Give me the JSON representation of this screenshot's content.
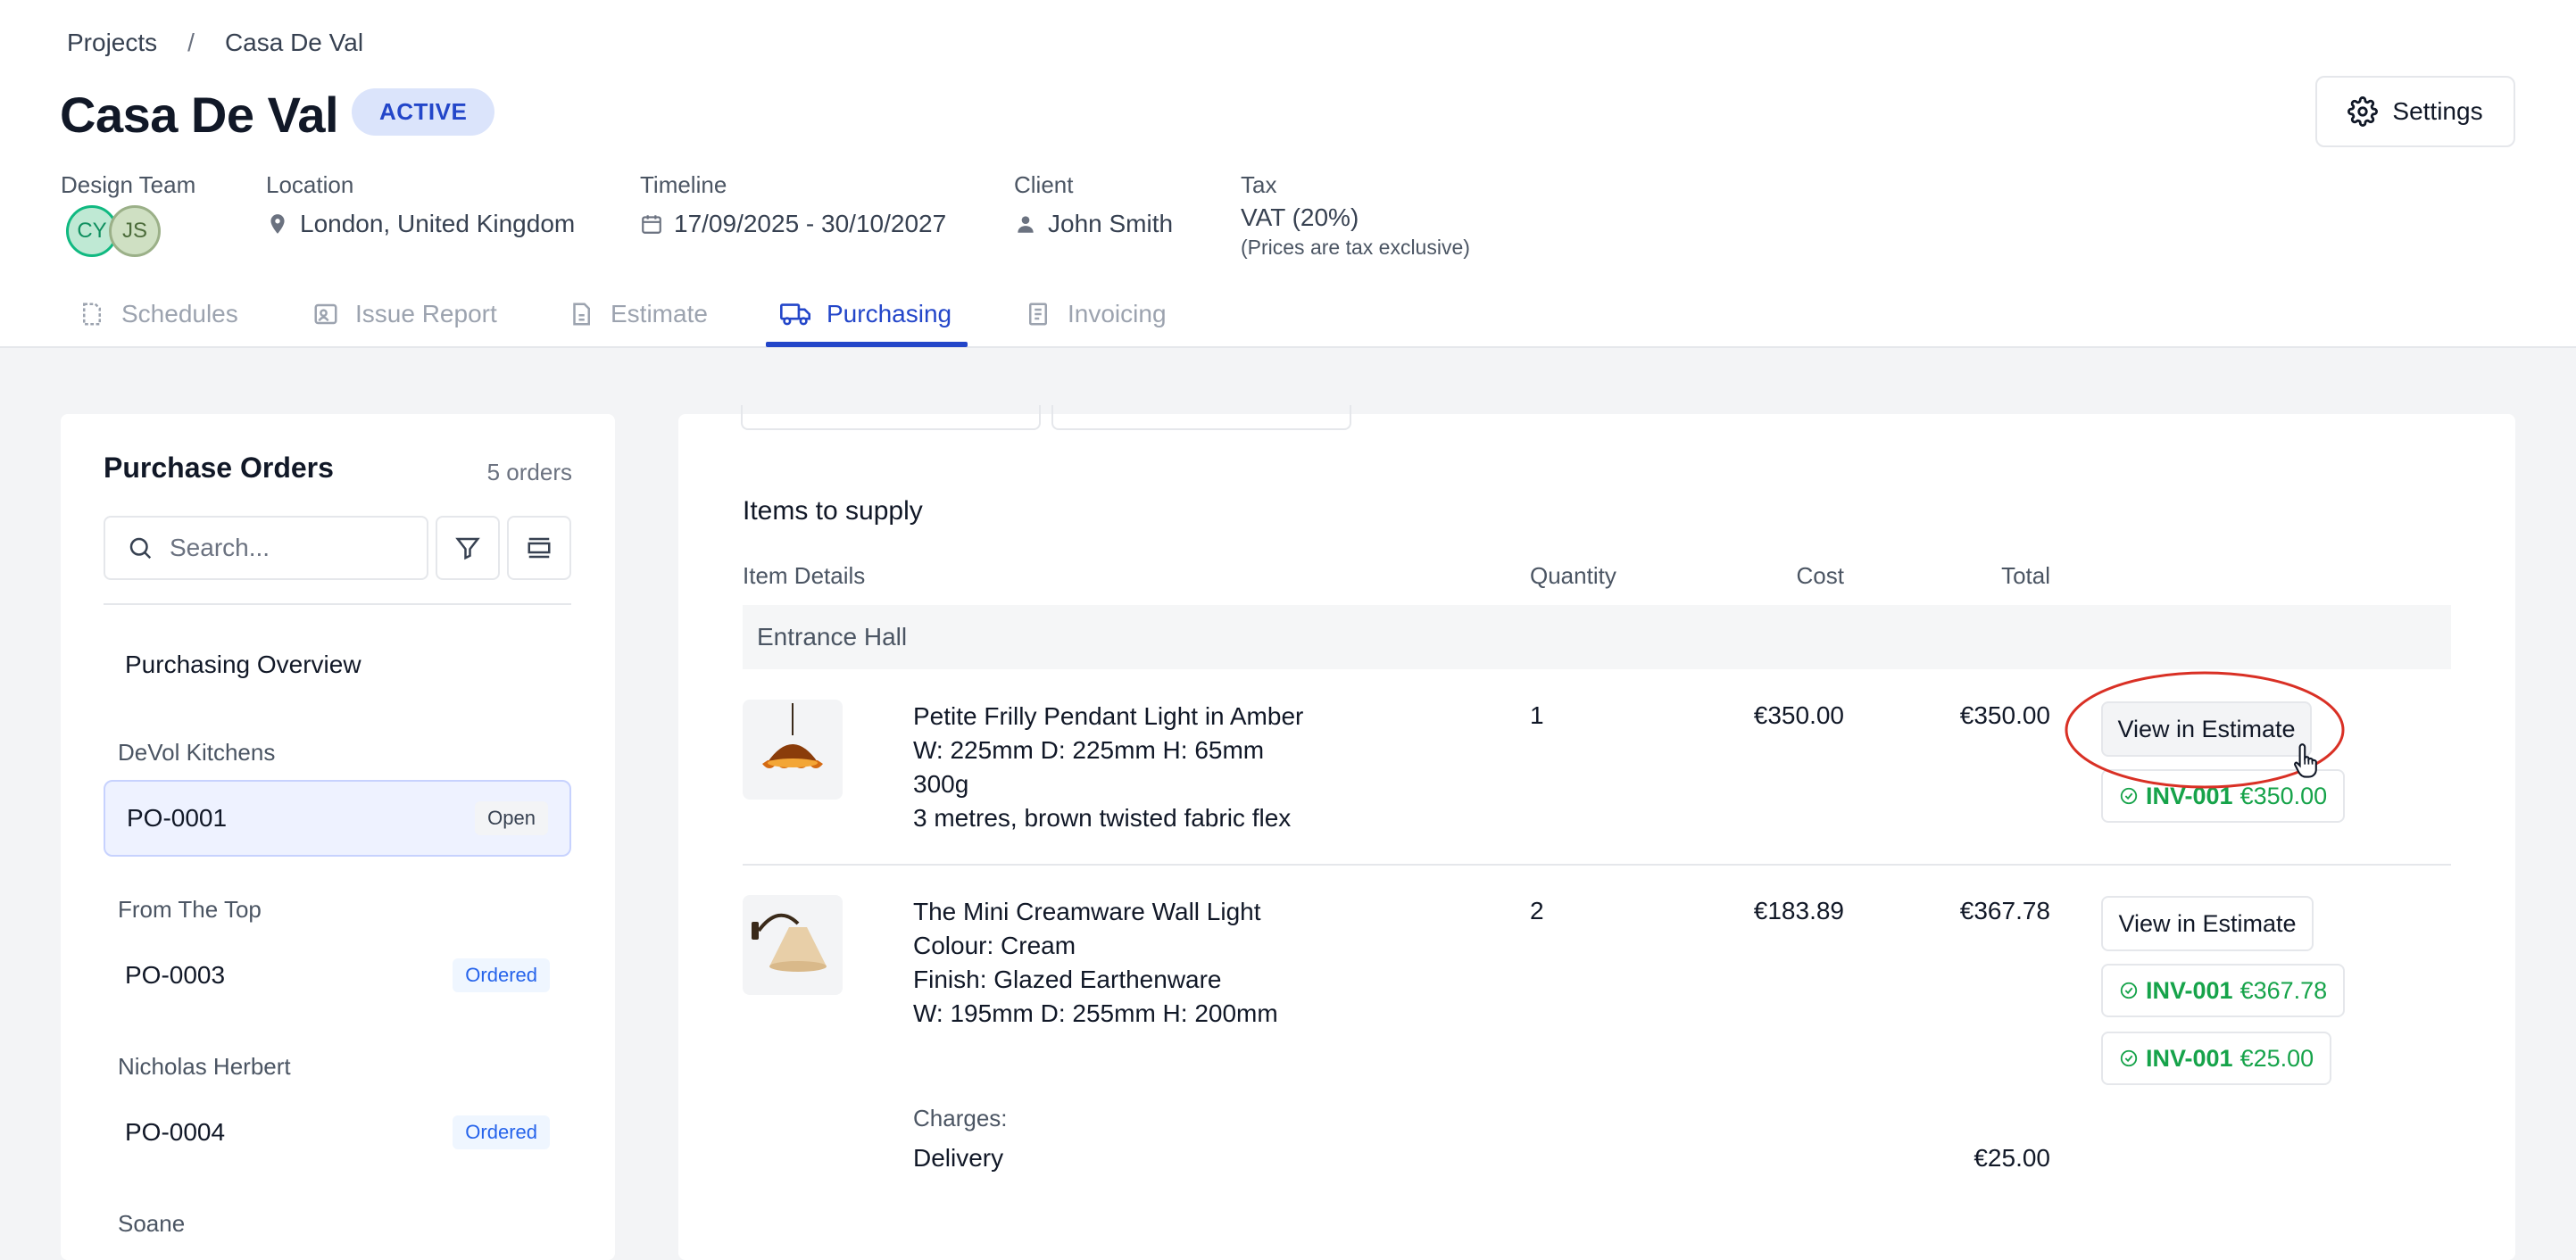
{
  "breadcrumb": {
    "root": "Projects",
    "separator": "/",
    "current": "Casa De Val"
  },
  "project": {
    "title": "Casa De Val",
    "status": "ACTIVE"
  },
  "settings_label": "Settings",
  "meta": {
    "design_team_label": "Design Team",
    "avatars": [
      "CY",
      "JS"
    ],
    "location_label": "Location",
    "location": "London, United Kingdom",
    "timeline_label": "Timeline",
    "timeline": "17/09/2025 - 30/10/2027",
    "client_label": "Client",
    "client": "John Smith",
    "tax_label": "Tax",
    "tax": "VAT (20%)",
    "tax_note": "(Prices are tax exclusive)"
  },
  "tabs": [
    {
      "label": "Schedules",
      "icon": "document-icon"
    },
    {
      "label": "Issue Report",
      "icon": "report-icon"
    },
    {
      "label": "Estimate",
      "icon": "file-icon"
    },
    {
      "label": "Purchasing",
      "icon": "truck-icon"
    },
    {
      "label": "Invoicing",
      "icon": "invoice-icon"
    }
  ],
  "sidebar": {
    "title": "Purchase Orders",
    "count": "5 orders",
    "search_placeholder": "Search...",
    "overview": "Purchasing Overview",
    "groups": [
      {
        "supplier": "DeVol Kitchens",
        "po": "PO-0001",
        "status": "Open"
      },
      {
        "supplier": "From The Top",
        "po": "PO-0003",
        "status": "Ordered"
      },
      {
        "supplier": "Nicholas Herbert",
        "po": "PO-0004",
        "status": "Ordered"
      },
      {
        "supplier": "Soane",
        "po": "",
        "status": ""
      }
    ]
  },
  "items": {
    "heading": "Items to supply",
    "columns": {
      "details": "Item Details",
      "quantity": "Quantity",
      "cost": "Cost",
      "total": "Total"
    },
    "section": "Entrance Hall",
    "rows": [
      {
        "lines": [
          "Petite Frilly Pendant Light in Amber",
          "W: 225mm D: 225mm H: 65mm",
          "300g",
          "3 metres, brown twisted fabric flex"
        ],
        "quantity": "1",
        "cost": "€350.00",
        "total": "€350.00",
        "button": "View in Estimate",
        "invoices": [
          {
            "id": "INV-001",
            "amount": "€350.00"
          }
        ]
      },
      {
        "lines": [
          "The Mini Creamware Wall Light",
          "Colour: Cream",
          "Finish: Glazed Earthenware",
          "W: 195mm D: 255mm H: 200mm"
        ],
        "quantity": "2",
        "cost": "€183.89",
        "total": "€367.78",
        "button": "View in Estimate",
        "invoices": [
          {
            "id": "INV-001",
            "amount": "€367.78"
          },
          {
            "id": "INV-001",
            "amount": "€25.00"
          }
        ]
      }
    ],
    "charges_label": "Charges:",
    "charge_name": "Delivery",
    "charge_total": "€25.00"
  },
  "colors": {
    "accent": "#2346c9",
    "success": "#16a34a",
    "highlight_ring": "#d93025"
  }
}
